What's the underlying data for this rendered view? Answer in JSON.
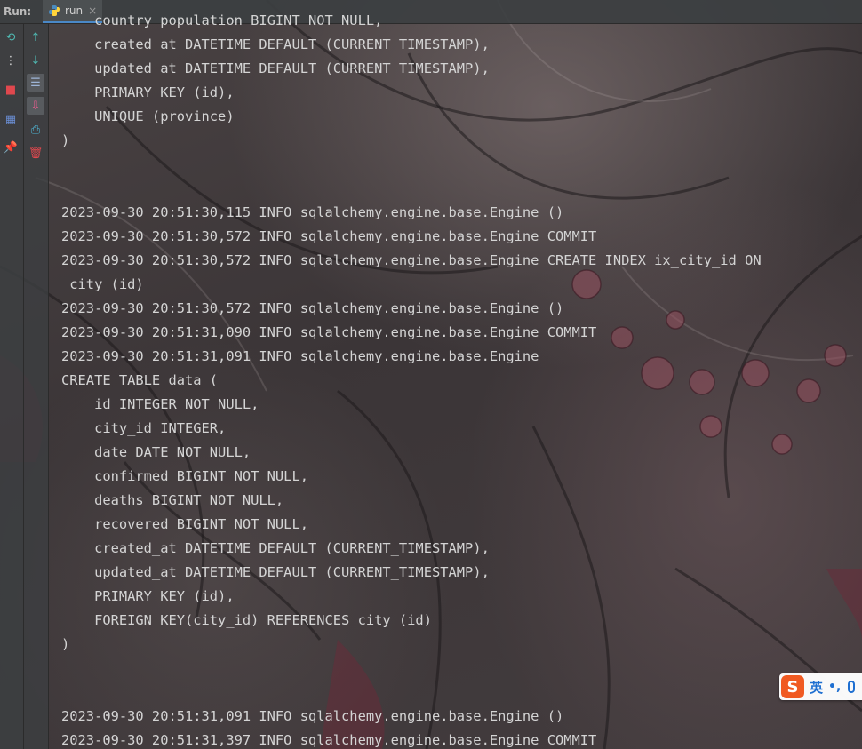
{
  "run_bar": {
    "label": "Run:",
    "tab_label": "run",
    "close_glyph": "×"
  },
  "toolbar_primary": [
    {
      "name": "rerun-icon",
      "glyph": "⟲",
      "color": "#4fb7b0"
    },
    {
      "name": "more-options-icon",
      "glyph": "⋮",
      "color": "#dddddd"
    },
    {
      "name": "stop-icon",
      "glyph": "■",
      "color": "#e0484e"
    },
    {
      "name": "layout-icon",
      "glyph": "▦",
      "color": "#6b8fd6"
    },
    {
      "name": "pin-icon",
      "glyph": "📌",
      "color": "#c86bd6"
    }
  ],
  "toolbar_secondary": [
    {
      "name": "scroll-up-icon",
      "glyph": "↑",
      "color": "#4fb7b0"
    },
    {
      "name": "scroll-down-icon",
      "glyph": "↓",
      "color": "#4fb7b0"
    },
    {
      "name": "soft-wrap-icon",
      "glyph": "☰",
      "color": "#9db4d6"
    },
    {
      "name": "scroll-to-end-icon",
      "glyph": "⇩",
      "color": "#e45c8c"
    },
    {
      "name": "print-icon",
      "glyph": "⎙",
      "color": "#4fb7d6"
    },
    {
      "name": "clear-all-icon",
      "glyph": "🗑",
      "color": "#e0484e"
    }
  ],
  "console_lines": [
    "    country_population BIGINT NOT NULL,",
    "    created_at DATETIME DEFAULT (CURRENT_TIMESTAMP),",
    "    updated_at DATETIME DEFAULT (CURRENT_TIMESTAMP),",
    "    PRIMARY KEY (id),",
    "    UNIQUE (province)",
    ")",
    "",
    "",
    "2023-09-30 20:51:30,115 INFO sqlalchemy.engine.base.Engine ()",
    "2023-09-30 20:51:30,572 INFO sqlalchemy.engine.base.Engine COMMIT",
    "2023-09-30 20:51:30,572 INFO sqlalchemy.engine.base.Engine CREATE INDEX ix_city_id ON",
    " city (id)",
    "2023-09-30 20:51:30,572 INFO sqlalchemy.engine.base.Engine ()",
    "2023-09-30 20:51:31,090 INFO sqlalchemy.engine.base.Engine COMMIT",
    "2023-09-30 20:51:31,091 INFO sqlalchemy.engine.base.Engine",
    "CREATE TABLE data (",
    "    id INTEGER NOT NULL,",
    "    city_id INTEGER,",
    "    date DATE NOT NULL,",
    "    confirmed BIGINT NOT NULL,",
    "    deaths BIGINT NOT NULL,",
    "    recovered BIGINT NOT NULL,",
    "    created_at DATETIME DEFAULT (CURRENT_TIMESTAMP),",
    "    updated_at DATETIME DEFAULT (CURRENT_TIMESTAMP),",
    "    PRIMARY KEY (id),",
    "    FOREIGN KEY(city_id) REFERENCES city (id)",
    ")",
    "",
    "",
    "2023-09-30 20:51:31,091 INFO sqlalchemy.engine.base.Engine ()",
    "2023-09-30 20:51:31,397 INFO sqlalchemy.engine.base.Engine COMMIT"
  ],
  "ime": {
    "logo": "S",
    "mode": "英",
    "punct": "•,"
  }
}
